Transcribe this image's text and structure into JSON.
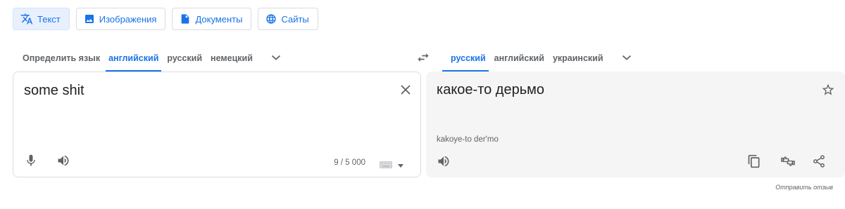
{
  "modes": [
    {
      "label": "Текст",
      "icon": "translate-icon",
      "active": true
    },
    {
      "label": "Изображения",
      "icon": "image-icon",
      "active": false
    },
    {
      "label": "Документы",
      "icon": "document-icon",
      "active": false
    },
    {
      "label": "Сайты",
      "icon": "globe-icon",
      "active": false
    }
  ],
  "source": {
    "languages": [
      "Определить язык",
      "английский",
      "русский",
      "немецкий"
    ],
    "selected_language": "английский",
    "text": "some shit",
    "char_count": "9 / 5 000"
  },
  "target": {
    "languages": [
      "русский",
      "английский",
      "украинский"
    ],
    "selected_language": "русский",
    "text": "какое-то дерьмо",
    "transliteration": "kakoye-to der'mo"
  },
  "feedback_link": "Отправить отзыв",
  "colors": {
    "accent": "#1a73e8",
    "icon": "#5f6368",
    "target_panel_bg": "#f5f5f5",
    "chip_active_bg": "#e8f0fe"
  }
}
